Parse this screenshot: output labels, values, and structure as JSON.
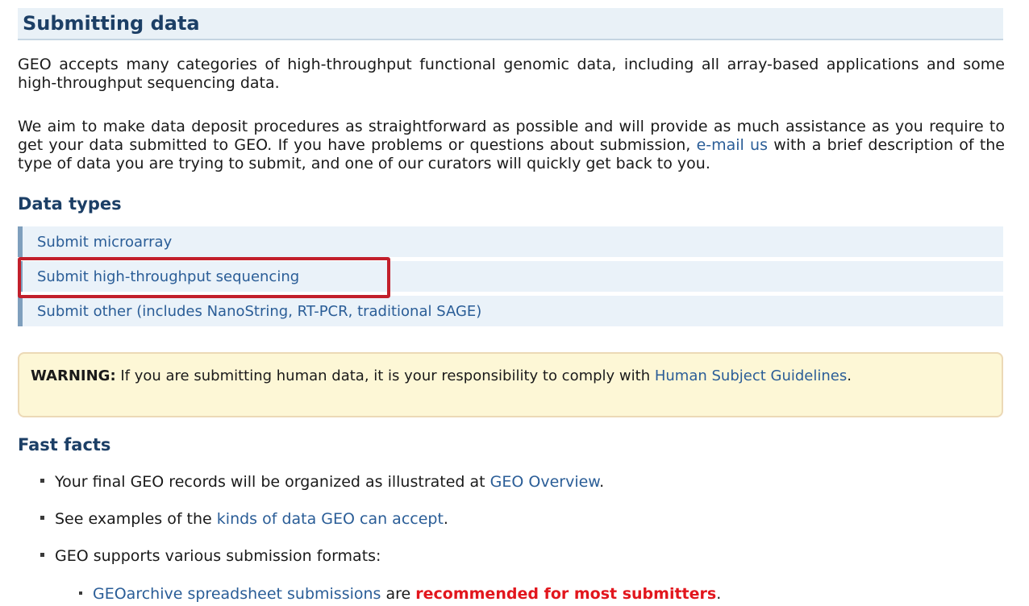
{
  "section_title": "Submitting data",
  "intro": "GEO accepts many categories of high-throughput functional genomic data, including all array-based applications and some high-throughput sequencing data.",
  "assist": {
    "before": "We aim to make data deposit procedures as straightforward as possible and will provide as much assistance as you require to get your data submitted to GEO. If you have problems or questions about submission, ",
    "link": "e-mail us",
    "after": " with a brief description of the type of data you are trying to submit, and one of our curators will quickly get back to you."
  },
  "data_types": {
    "heading": "Data types",
    "items": [
      "Submit microarray",
      "Submit high-throughput sequencing",
      "Submit other (includes NanoString, RT-PCR, traditional SAGE)"
    ]
  },
  "warning": {
    "label": "WARNING:",
    "text": " If you are submitting human data, it is your responsibility to comply with ",
    "link": "Human Subject Guidelines",
    "end": "."
  },
  "fast_facts": {
    "heading": "Fast facts",
    "b1": {
      "before": "Your final GEO records will be organized as illustrated at ",
      "link": "GEO Overview",
      "after": "."
    },
    "b2": {
      "before": "See examples of the ",
      "link": "kinds of data GEO can accept",
      "after": "."
    },
    "b3": {
      "text": "GEO supports various submission formats:"
    },
    "b4": {
      "link": "GEOarchive spreadsheet submissions",
      "middle": " are ",
      "emphasis": "recommended for most submitters",
      "after": "."
    }
  },
  "colors": {
    "heading": "#1c3f66",
    "link": "#2a5d97",
    "highlight": "#c21f2b",
    "emphasis": "#e2161d"
  }
}
